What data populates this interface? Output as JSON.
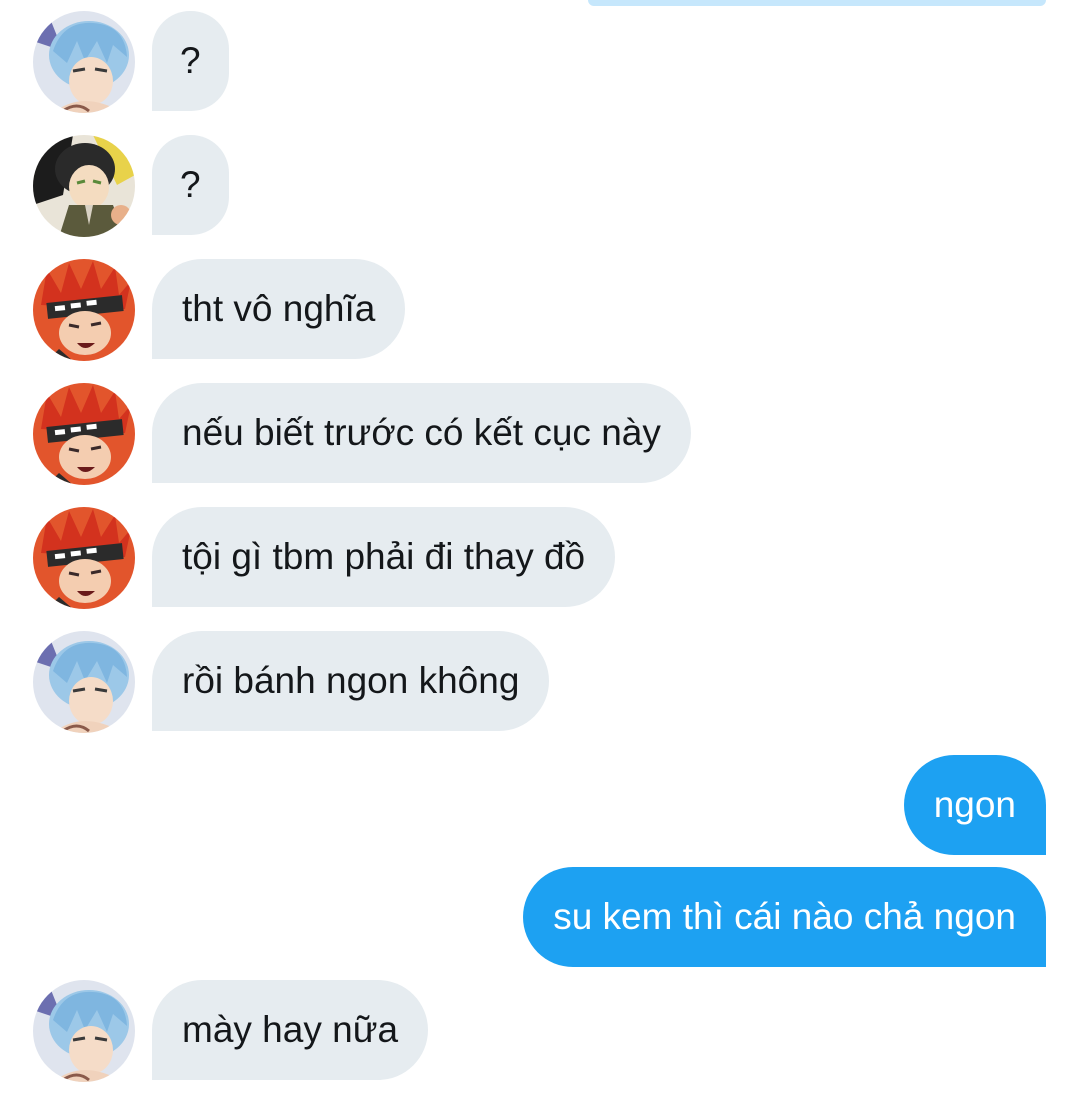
{
  "thread": {
    "messages": [
      {
        "sender": "blue-hair-user",
        "text": "?"
      },
      {
        "sender": "green-hair-user",
        "text": "?"
      },
      {
        "sender": "red-hair-user",
        "text": "tht vô nghĩa"
      },
      {
        "sender": "red-hair-user",
        "text": "nếu biết trước có kết cục này"
      },
      {
        "sender": "red-hair-user",
        "text": "tội gì tbm phải đi thay đồ"
      },
      {
        "sender": "blue-hair-user",
        "text": "rồi bánh ngon không"
      },
      {
        "sender": "me",
        "text": "ngon"
      },
      {
        "sender": "me",
        "text": "su kem thì cái nào chả ngon"
      },
      {
        "sender": "blue-hair-user",
        "text": "mày hay nữa"
      }
    ]
  },
  "colors": {
    "incoming_bubble": "#e6ecf0",
    "outgoing_bubble": "#1da1f2",
    "incoming_text": "#14171a",
    "outgoing_text": "#ffffff"
  },
  "icons": {
    "avatar_blue": "blue-hair-avatar-icon",
    "avatar_green": "green-hair-avatar-icon",
    "avatar_red": "red-hair-avatar-icon"
  }
}
